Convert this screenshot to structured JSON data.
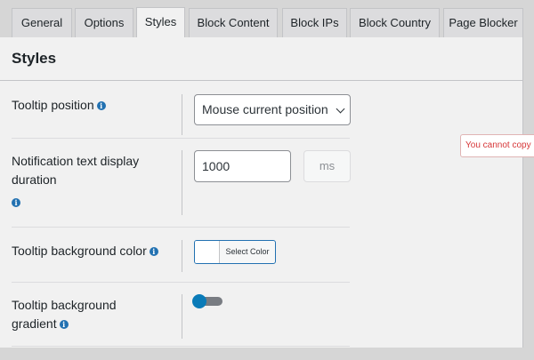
{
  "tabs": [
    {
      "label": "General",
      "active": false
    },
    {
      "label": "Options",
      "active": false
    },
    {
      "label": "Styles",
      "active": true
    },
    {
      "label": "Block Content",
      "active": false
    },
    {
      "label": "Block IPs",
      "active": false
    },
    {
      "label": "Block Country",
      "active": false
    },
    {
      "label": "Page Blocker",
      "active": false
    }
  ],
  "panel": {
    "title": "Styles",
    "fields": {
      "tooltip_position": {
        "label": "Tooltip position",
        "value": "Mouse current position"
      },
      "notification_duration": {
        "label_line1": "Notification text display",
        "label_line2": "duration",
        "value": "1000",
        "unit": "ms"
      },
      "tooltip_bg_color": {
        "label": "Tooltip background color",
        "button_label": "Select Color",
        "current_color": "#ffffff"
      },
      "tooltip_bg_gradient": {
        "label_line1": "Tooltip background",
        "label_line2": "gradient",
        "enabled": false
      }
    }
  },
  "info_icon_glyph": "i",
  "tooltip_message": "You cannot copy",
  "colors": {
    "accent": "#2271b1",
    "toggle_knob": "#0a7bb8",
    "error": "#d63638"
  }
}
